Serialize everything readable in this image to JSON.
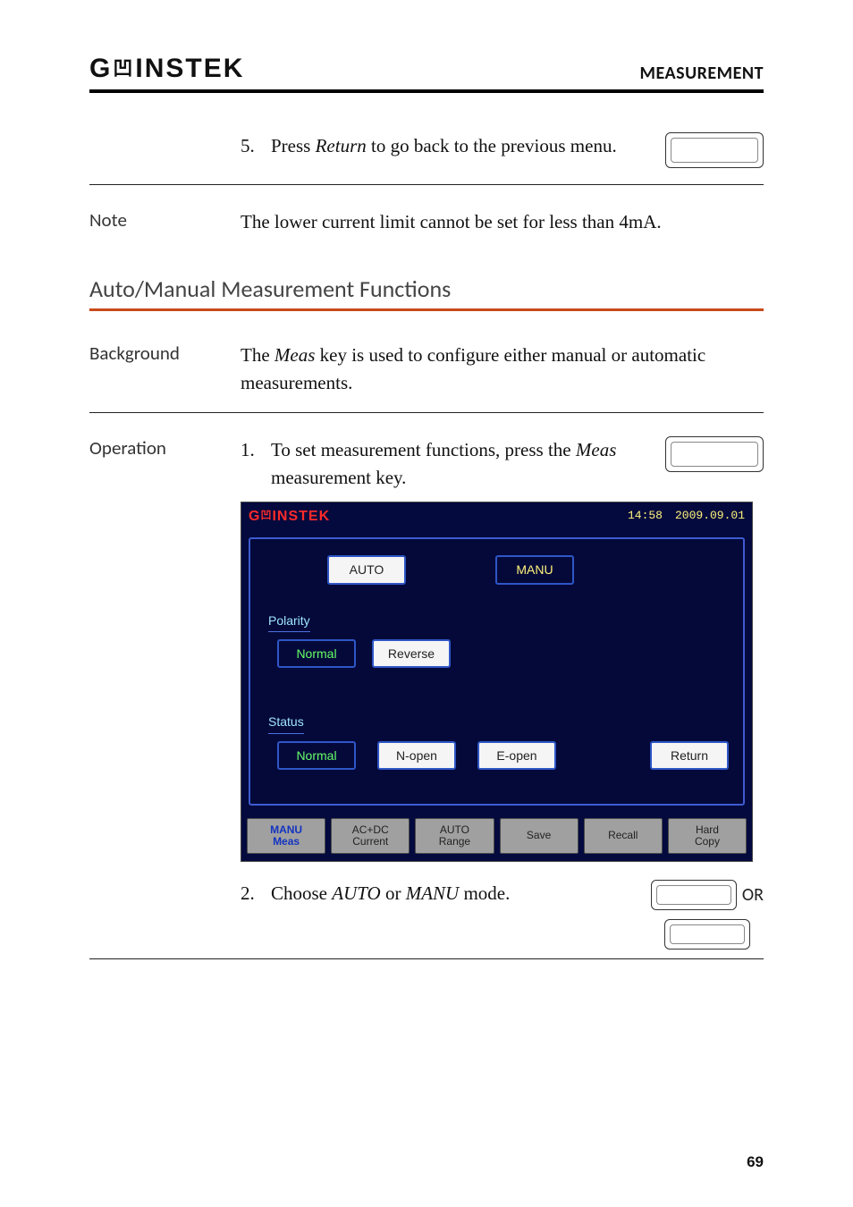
{
  "header": {
    "brand_gw": "G",
    "brand_instek": "INSTEK",
    "brand_full": "GWINSTEK",
    "section": "MEASUREMENT"
  },
  "step5": {
    "num": "5.",
    "text_a": "Press ",
    "text_key": "Return",
    "text_b": " to go back to the previous menu."
  },
  "note": {
    "label": "Note",
    "text": "The lower current limit cannot be set for less than 4mA."
  },
  "section_heading": "Auto/Manual Measurement Functions",
  "background": {
    "label": "Background",
    "text_a": "The ",
    "text_key": "Meas",
    "text_b": " key is used to configure either manual or automatic measurements."
  },
  "operation": {
    "label": "Operation",
    "step1": {
      "num": "1.",
      "text_a": "To set measurement functions, press the ",
      "text_key": "Meas",
      "text_b": " measurement key."
    },
    "step2": {
      "num": "2.",
      "text_a": "Choose ",
      "text_key1": "AUTO",
      "text_mid": " or ",
      "text_key2": "MANU",
      "text_b": " mode.",
      "or": "OR"
    }
  },
  "screenshot": {
    "brand": "GWINSTEK",
    "time": "14:58",
    "date": "2009.09.01",
    "mode_auto": "AUTO",
    "mode_manu": "MANU",
    "polarity_label": "Polarity",
    "polarity_normal": "Normal",
    "polarity_reverse": "Reverse",
    "status_label": "Status",
    "status_normal": "Normal",
    "status_nopen": "N-open",
    "status_eopen": "E-open",
    "return": "Return",
    "tabs": {
      "manu_l1": "MANU",
      "manu_l2": "Meas",
      "acdc_l1": "AC+DC",
      "acdc_l2": "Current",
      "auto_l1": "AUTO",
      "auto_l2": "Range",
      "save": "Save",
      "recall": "Recall",
      "hard_l1": "Hard",
      "hard_l2": "Copy"
    }
  },
  "page_number": "69"
}
